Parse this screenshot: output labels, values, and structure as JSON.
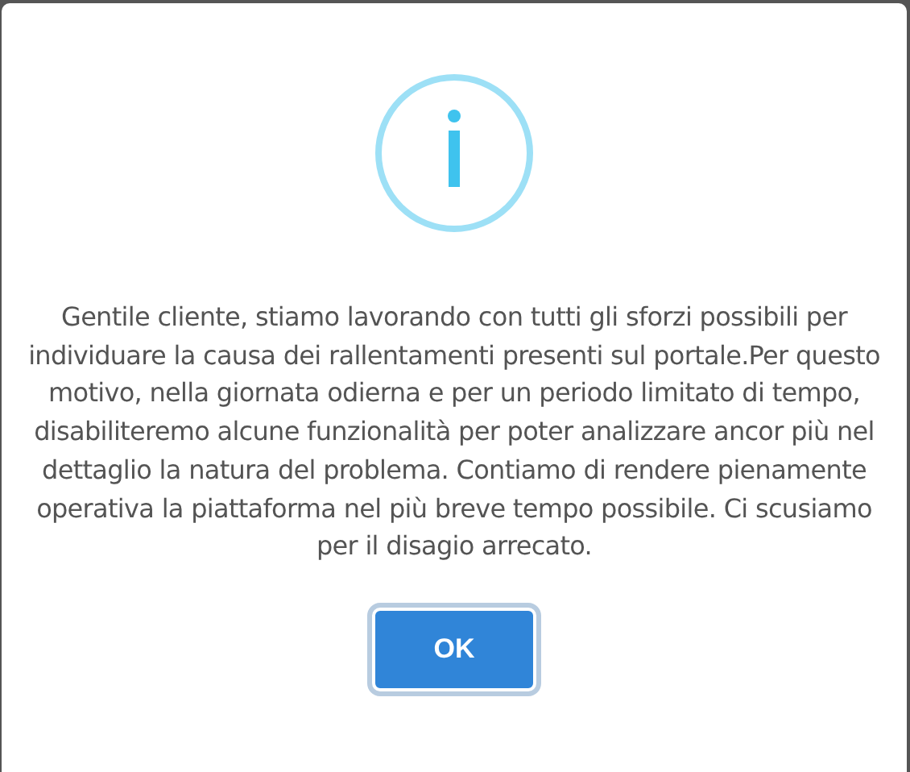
{
  "dialog": {
    "message": "Gentile cliente, stiamo lavorando con tutti gli sforzi possibili per individuare la causa dei rallentamenti presenti sul portale.Per questo motivo, nella giornata odierna e per un periodo limitato di tempo, disabiliteremo alcune funzionalità per poter analizzare ancor più nel dettaglio la natura del problema. Contiamo di rendere pienamente operativa la piattaforma nel più breve tempo possibile. Ci scusiamo per il disagio arrecato.",
    "buttons": [
      "OK"
    ]
  }
}
